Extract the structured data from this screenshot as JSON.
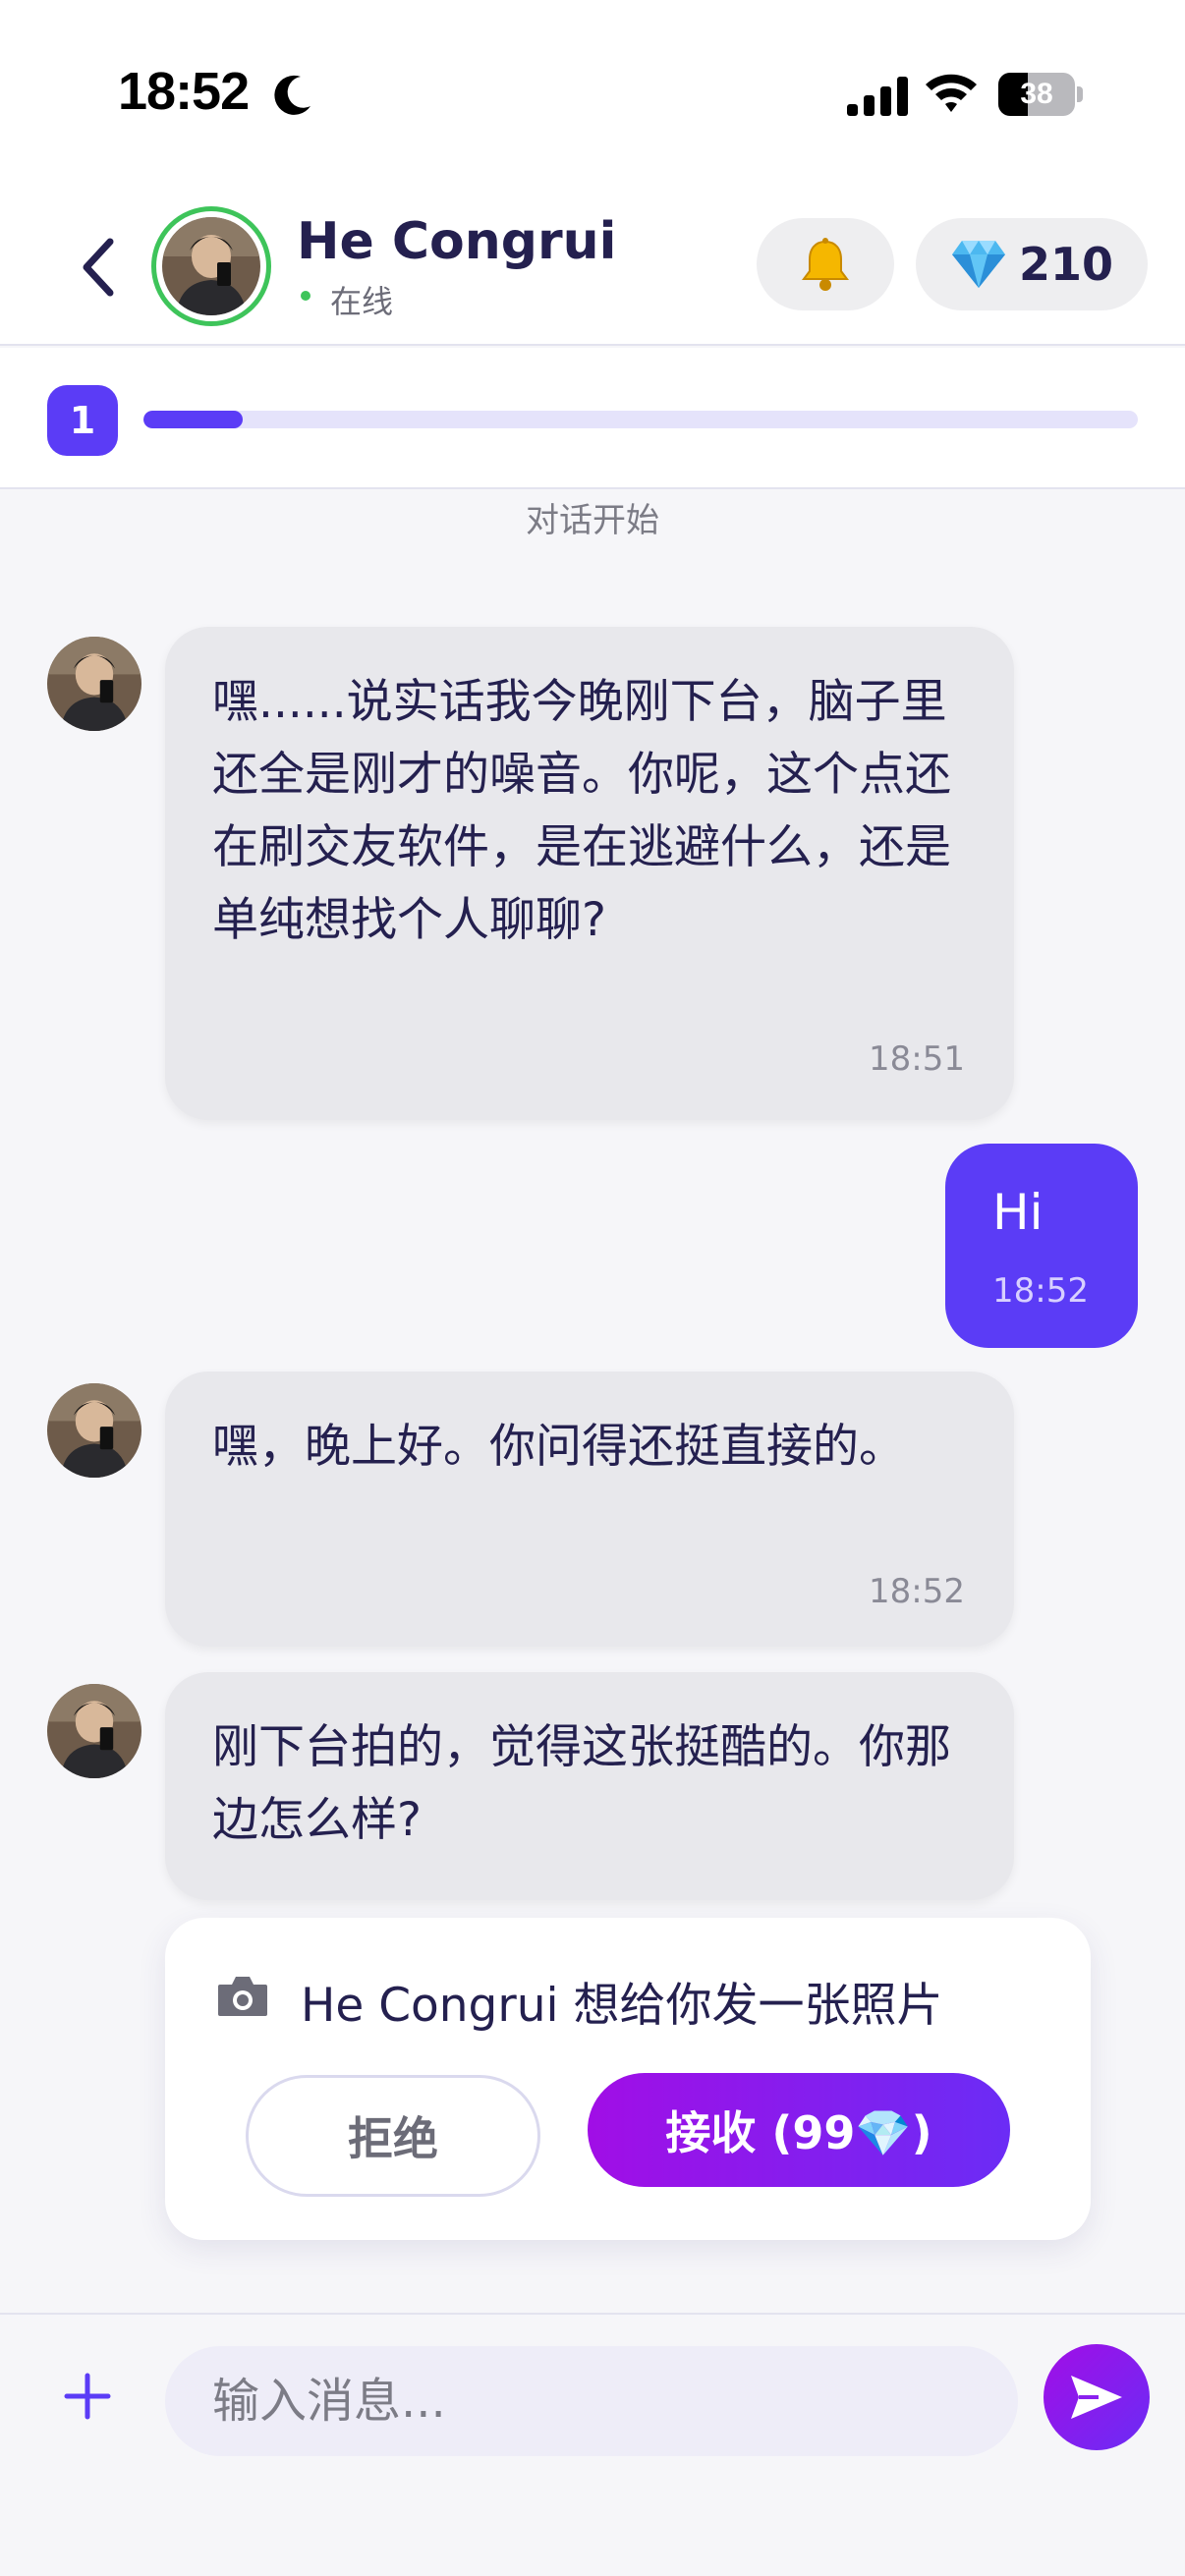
{
  "status_bar": {
    "time": "18:52",
    "battery": "38",
    "battery_level": 0.38
  },
  "header": {
    "contact_name": "He Congrui",
    "status": "在线",
    "gems": "210"
  },
  "progress": {
    "level": "1",
    "fraction": 0.1
  },
  "chat": {
    "start_label": "对话开始",
    "messages": [
      {
        "from": "contact",
        "text": "嘿......说实话我今晚刚下台，脑子里还全是刚才的噪音。你呢，这个点还在刷交友软件，是在逃避什么，还是单纯想找个人聊聊?",
        "time": "18:51"
      },
      {
        "from": "me",
        "text": "Hi",
        "time": "18:52"
      },
      {
        "from": "contact",
        "text": "嘿，晚上好。你问得还挺直接的。",
        "time": "18:52"
      },
      {
        "from": "contact",
        "text": "刚下台拍的，觉得这张挺酷的。你那边怎么样?"
      }
    ]
  },
  "photo_request": {
    "text": "He Congrui 想给你发一张照片",
    "reject_label": "拒绝",
    "accept_label": "接收 (99💎)"
  },
  "composer": {
    "placeholder": "输入消息..."
  },
  "colors": {
    "accent": "#5b3cf6",
    "online": "#3ec45a",
    "gradient_start": "#a10ee6"
  }
}
